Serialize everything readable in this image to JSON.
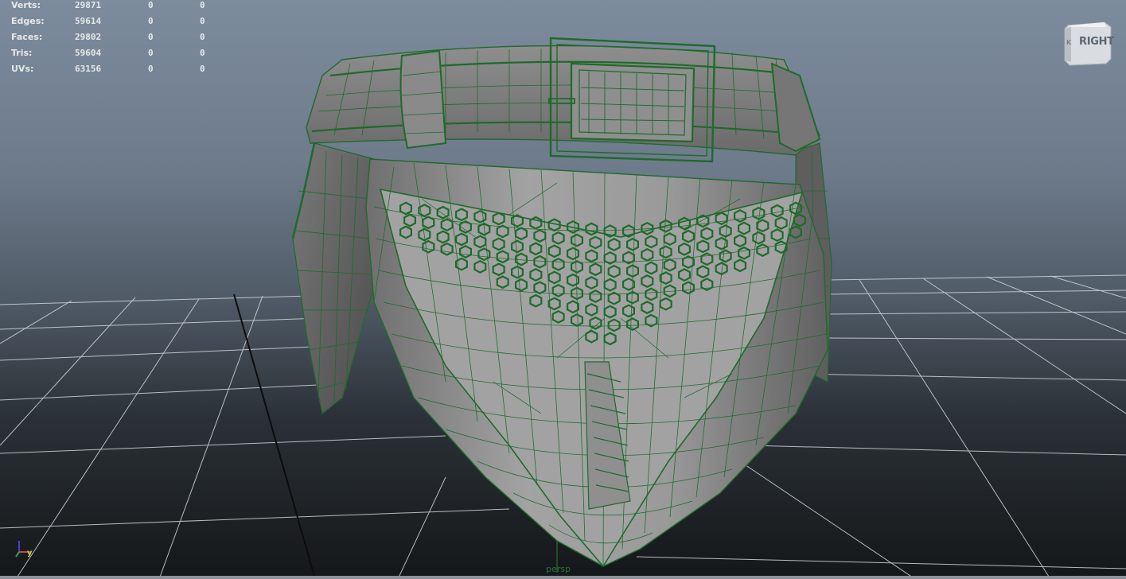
{
  "hud": {
    "rows": [
      {
        "label": "Verts:",
        "v1": "29871",
        "v2": "0",
        "v3": "0"
      },
      {
        "label": "Edges:",
        "v1": "59614",
        "v2": "0",
        "v3": "0"
      },
      {
        "label": "Faces:",
        "v1": "29802",
        "v2": "0",
        "v3": "0"
      },
      {
        "label": "Tris:",
        "v1": "59604",
        "v2": "0",
        "v3": "0"
      },
      {
        "label": "UVs:",
        "v1": "63156",
        "v2": "0",
        "v3": "0"
      }
    ]
  },
  "viewcube": {
    "label": "RIGHT",
    "icon": "view-cube-icon"
  },
  "camera": {
    "name": "persp"
  },
  "axis_gizmo": {
    "y_label": "y",
    "icon": "axis-gizmo-icon"
  },
  "colors": {
    "wireframe": "#1f6a2c",
    "mesh_light": "#9a9a9a",
    "mesh_dark": "#555555",
    "grid_line": "#d8dde2",
    "hud_text": "#e6e8ea"
  }
}
